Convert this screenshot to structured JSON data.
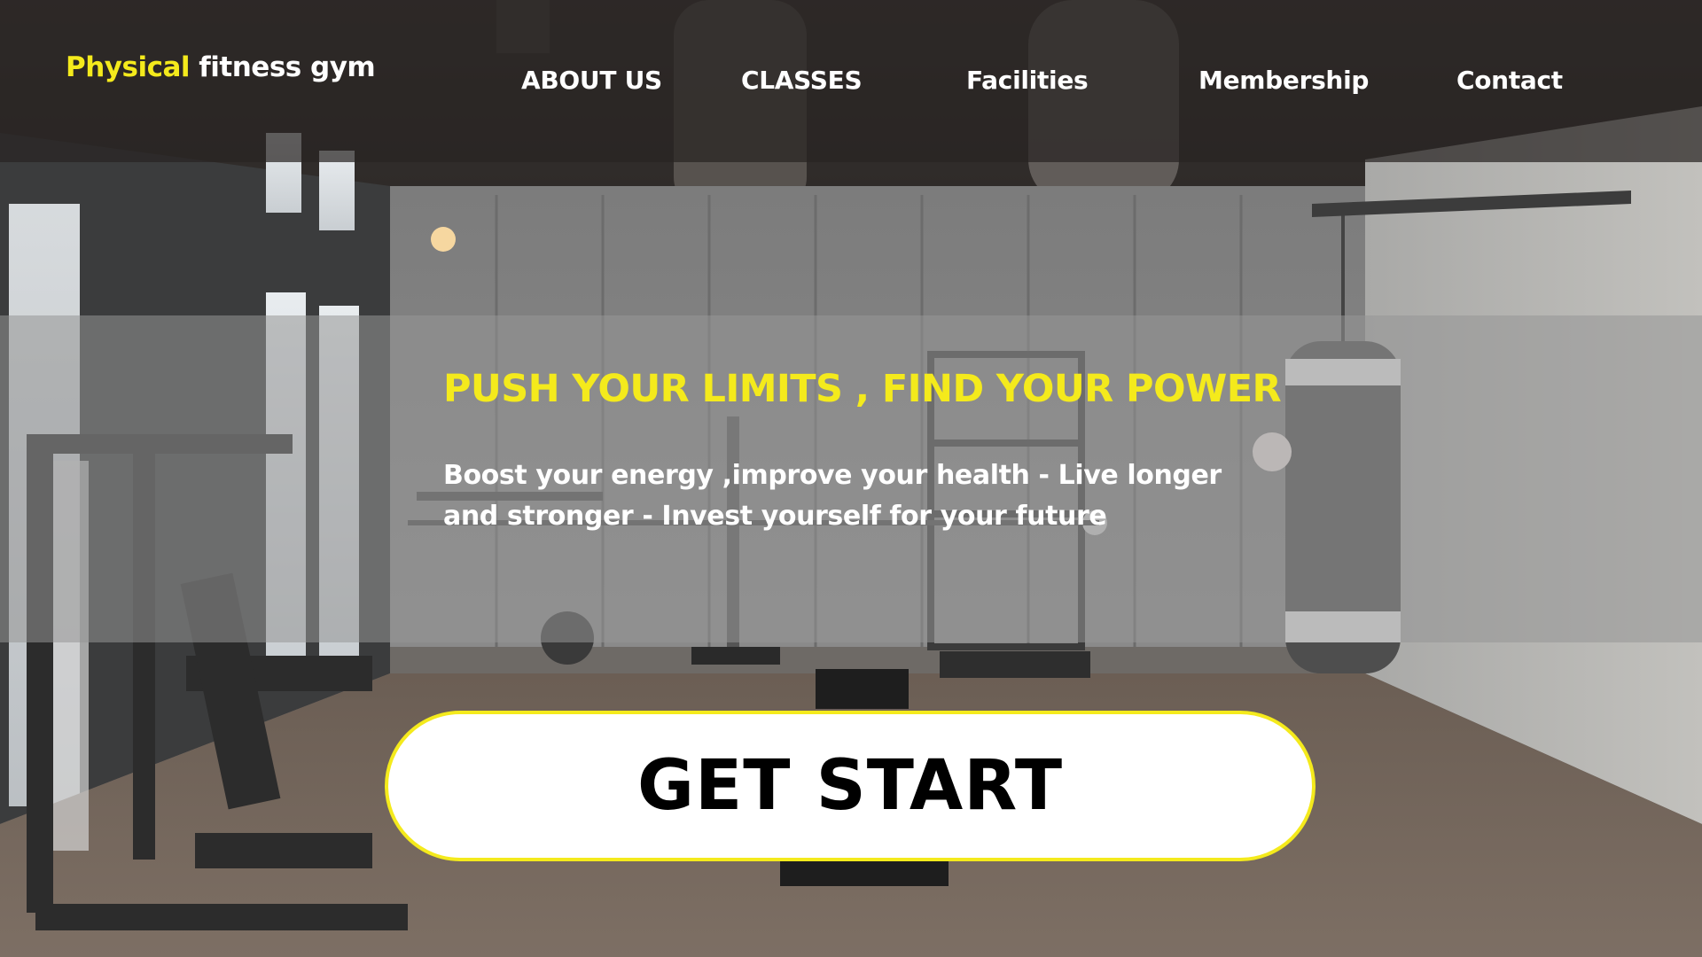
{
  "header": {
    "brand_highlight": "Physical",
    "brand_rest": " fitness gym",
    "nav": [
      {
        "label": "ABOUT US"
      },
      {
        "label": "CLASSES"
      },
      {
        "label": "Facilities"
      },
      {
        "label": "Membership"
      },
      {
        "label": "Contact"
      }
    ]
  },
  "hero": {
    "headline": "PUSH YOUR LIMITS , FIND YOUR POWER",
    "subtext": "Boost your energy ,improve your health - Live longer and stronger - Invest yourself for your future",
    "cta_label": "GET START"
  },
  "colors": {
    "accent": "#f4ea1c",
    "header_bg": "#282422",
    "text_light": "#ffffff",
    "button_bg": "#ffffff",
    "button_text": "#000000"
  },
  "icons": [
    "punching-bag-icon",
    "weight-machine-icon"
  ]
}
